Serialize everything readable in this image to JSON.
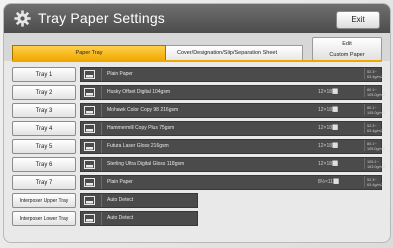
{
  "title": "Tray Paper Settings",
  "exit_label": "Exit",
  "tabs": [
    {
      "label": "Paper Tray",
      "active": true
    },
    {
      "label": "Cover/Designation/Slip/Separation Sheet",
      "active": false
    }
  ],
  "edit_custom_paper": {
    "line1": "Edit",
    "line2": "Custom Paper"
  },
  "colors": {
    "accent": "#f0a800",
    "info_bg": "#4b4b4b",
    "title_bar": "#555555"
  },
  "rows": [
    {
      "label": "Tray 1",
      "paper": "Plain Paper",
      "size": "",
      "weight": "52.3~ 63.4g/m2",
      "icon": "paper-tray-icon"
    },
    {
      "label": "Tray 2",
      "paper": "Husky Offset Digital 104gsm",
      "size": "12×18⬜",
      "weight": "80.1~ 105.0g/m2",
      "icon": "paper-tray-icon"
    },
    {
      "label": "Tray 3",
      "paper": "Mohawk Color Copy 98 216gsm",
      "size": "12×18⬜",
      "weight": "80.1~ 105.0g/m2",
      "icon": "paper-tray-icon"
    },
    {
      "label": "Tray 4",
      "paper": "Hammermill Copy Plus 75gsm",
      "size": "12×18⬜",
      "weight": "52.3~ 63.4g/m2",
      "icon": "paper-tray-icon"
    },
    {
      "label": "Tray 5",
      "paper": "Futura Laser Gloss 216gsm",
      "size": "12×18⬜",
      "weight": "80.1~ 105.0g/m2",
      "icon": "paper-tray-icon"
    },
    {
      "label": "Tray 6",
      "paper": "Sterling Ultra Digital Gloss 118gsm",
      "size": "12×18⬜",
      "weight": "105.1~ 163.0g/m2",
      "icon": "paper-tray-icon"
    },
    {
      "label": "Tray 7",
      "paper": "Plain Paper",
      "size": "8½×11⬜",
      "weight": "52.3~ 63.4g/m2",
      "icon": "paper-tray-icon"
    },
    {
      "label": "Interposer Upper Tray",
      "paper": "Auto Detect",
      "size": "",
      "weight": "",
      "icon": "paper-tray-icon",
      "short": true
    },
    {
      "label": "Interposer Lower Tray",
      "paper": "Auto Detect",
      "size": "",
      "weight": "",
      "icon": "paper-tray-icon",
      "short": true
    }
  ]
}
